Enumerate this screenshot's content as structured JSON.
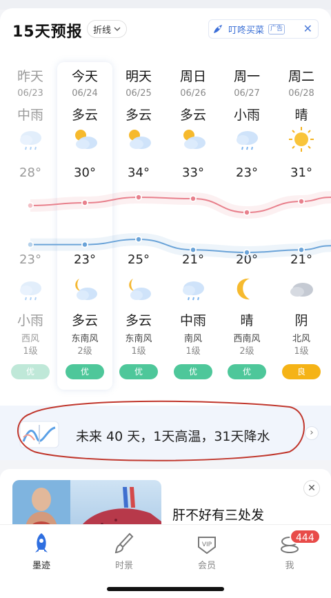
{
  "header": {
    "title": "15天预报",
    "mode_label": "折线",
    "ad_text": "叮咚买菜",
    "ad_tag": "广告"
  },
  "days": [
    {
      "day": "昨天",
      "date": "06/23",
      "day_weather": "中雨",
      "day_icon": "rain-cloud-icon",
      "high": "28°",
      "low": "23°",
      "night_icon": "rain-cloud-icon",
      "night_weather": "小雨",
      "wind": "西风",
      "level": "1级",
      "aqi": "优",
      "aqi_color": "#bfe8d8",
      "past": true,
      "high_value": 28,
      "low_value": 23
    },
    {
      "day": "今天",
      "date": "06/24",
      "day_weather": "多云",
      "day_icon": "sun-cloud-icon",
      "high": "30°",
      "low": "23°",
      "night_icon": "moon-cloud-icon",
      "night_weather": "多云",
      "wind": "东南风",
      "level": "2级",
      "aqi": "优",
      "aqi_color": "#4ec79a",
      "past": false,
      "high_value": 30,
      "low_value": 23
    },
    {
      "day": "明天",
      "date": "06/25",
      "day_weather": "多云",
      "day_icon": "sun-cloud-icon",
      "high": "34°",
      "low": "25°",
      "night_icon": "moon-cloud-icon",
      "night_weather": "多云",
      "wind": "东南风",
      "level": "1级",
      "aqi": "优",
      "aqi_color": "#4ec79a",
      "past": false,
      "high_value": 34,
      "low_value": 25
    },
    {
      "day": "周日",
      "date": "06/26",
      "day_weather": "多云",
      "day_icon": "sun-cloud-icon",
      "high": "33°",
      "low": "21°",
      "night_icon": "rain-cloud-icon",
      "night_weather": "中雨",
      "wind": "南风",
      "level": "1级",
      "aqi": "优",
      "aqi_color": "#4ec79a",
      "past": false,
      "high_value": 33,
      "low_value": 21
    },
    {
      "day": "周一",
      "date": "06/27",
      "day_weather": "小雨",
      "day_icon": "rain-cloud-icon",
      "high": "23°",
      "low": "20°",
      "night_icon": "moon-icon",
      "night_weather": "晴",
      "wind": "西南风",
      "level": "2级",
      "aqi": "优",
      "aqi_color": "#4ec79a",
      "past": false,
      "high_value": 23,
      "low_value": 20
    },
    {
      "day": "周二",
      "date": "06/28",
      "day_weather": "晴",
      "day_icon": "sun-icon",
      "high": "31°",
      "low": "21°",
      "night_icon": "cloud-icon",
      "night_weather": "阴",
      "wind": "北风",
      "level": "1级",
      "aqi": "良",
      "aqi_color": "#f5b316",
      "past": false,
      "high_value": 31,
      "low_value": 21
    }
  ],
  "colors": {
    "high_line": "#e8808c",
    "low_line": "#6aa3d8"
  },
  "promo": {
    "text": "未来 40 天，1天高温，31天降水",
    "arrow": "›"
  },
  "ad_card": {
    "headline": "肝不好有三处发",
    "close": "✕"
  },
  "tabbar": {
    "tabs": [
      {
        "label": "墨迹",
        "icon": "rocket-icon"
      },
      {
        "label": "时景",
        "icon": "brush-icon"
      },
      {
        "label": "会员",
        "icon": "vip-icon"
      },
      {
        "label": "我",
        "icon": "profile-icon"
      }
    ],
    "badge": "444"
  }
}
